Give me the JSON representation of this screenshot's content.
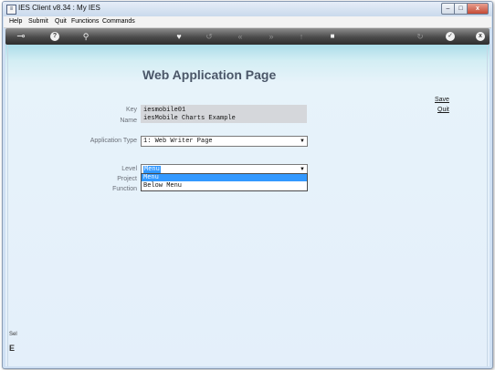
{
  "window": {
    "title": "IES Client v8.34 : My IES",
    "icon_text": "≡",
    "controls": {
      "minimize": "–",
      "maximize": "□",
      "close": "x"
    }
  },
  "menu": {
    "items": [
      "Help",
      "Submit",
      "Quit",
      "Functions",
      "Commands"
    ]
  },
  "toolbar": {
    "icons": [
      "key-icon",
      "help-icon",
      "search-icon",
      "heart-icon",
      "undo-icon",
      "rewind-icon",
      "fast-forward-icon",
      "up-arrow-icon",
      "stop-icon",
      "refresh-icon",
      "confirm-icon",
      "close-icon"
    ],
    "glyphs": {
      "key": "⊸",
      "help": "?",
      "search": "⚲",
      "heart": "♥",
      "undo": "↺",
      "rewind": "«",
      "forward": "»",
      "up": "↑",
      "stop": "■",
      "refresh": "↻",
      "confirm": "✓",
      "close": "x"
    }
  },
  "page": {
    "title": "Web Application Page",
    "actions": {
      "save": "Save",
      "quit": "Quit"
    },
    "fields": {
      "key": {
        "label": "Key",
        "value": "iesmobile01"
      },
      "name": {
        "label": "Name",
        "value": "iesMobile Charts Example"
      },
      "application_type": {
        "label": "Application Type",
        "value": "1: Web Writer Page"
      },
      "level": {
        "label": "Level",
        "value": "Menu",
        "options": [
          "Menu",
          "Below Menu"
        ],
        "highlighted_option": "Menu"
      },
      "project": {
        "label": "Project"
      },
      "function": {
        "label": "Function"
      }
    },
    "side_fragments": {
      "top": "Sel",
      "bottom": "E"
    }
  },
  "colors": {
    "toolbar_dark": "#2e2e2e",
    "selection_blue": "#3399ff",
    "title_text": "#4a5668",
    "content_top": "#acdde9"
  }
}
